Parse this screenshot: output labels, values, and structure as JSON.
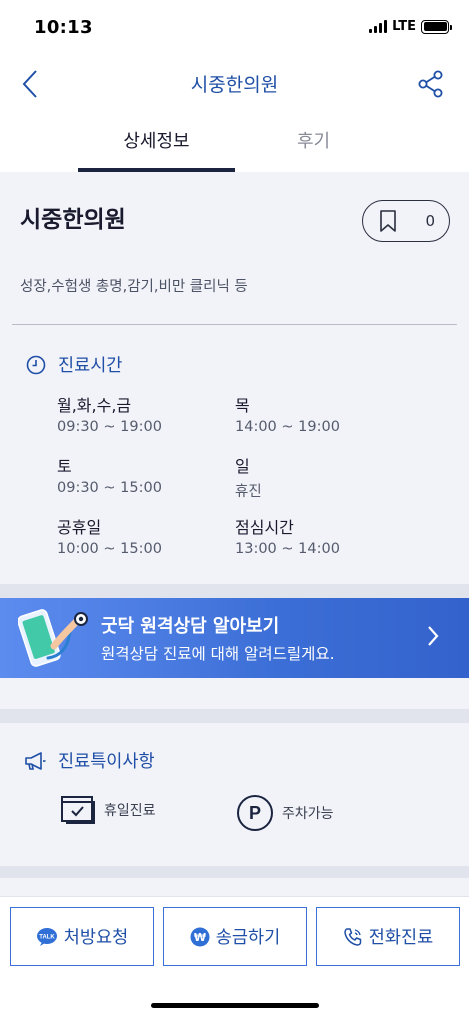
{
  "status": {
    "time": "10:13",
    "network": "LTE"
  },
  "header": {
    "title": "시중한의원"
  },
  "tabs": [
    {
      "label": "상세정보",
      "active": true
    },
    {
      "label": "후기",
      "active": false
    }
  ],
  "clinic": {
    "name": "시중한의원",
    "bookmark_count": "0",
    "tags": "성장,수험생 총명,감기,비만 클리닉 등"
  },
  "hours": {
    "title": "진료시간",
    "items": [
      {
        "day": "월,화,수,금",
        "time": "09:30 ~ 19:00"
      },
      {
        "day": "목",
        "time": "14:00 ~ 19:00"
      },
      {
        "day": "토",
        "time": "09:30 ~ 15:00"
      },
      {
        "day": "일",
        "time": "휴진"
      },
      {
        "day": "공휴일",
        "time": "10:00 ~ 15:00"
      },
      {
        "day": "점심시간",
        "time": "13:00 ~ 14:00"
      }
    ]
  },
  "banner": {
    "title": "굿닥 원격상담 알아보기",
    "subtitle": "원격상담 진료에 대해 알려드릴게요."
  },
  "special": {
    "title": "진료특이사항",
    "features": [
      {
        "label": "휴일진료",
        "icon": "calendar-check-icon"
      },
      {
        "label": "주차가능",
        "icon": "parking-icon"
      }
    ]
  },
  "actions": [
    {
      "label": "처방요청",
      "icon": "talk-icon"
    },
    {
      "label": "송금하기",
      "icon": "won-icon"
    },
    {
      "label": "전화진료",
      "icon": "phone-icon"
    }
  ],
  "colors": {
    "accent": "#1f4fa6",
    "button_border": "#3d6fd8",
    "banner": "#3b6ed6",
    "background": "#f1f3f9"
  }
}
